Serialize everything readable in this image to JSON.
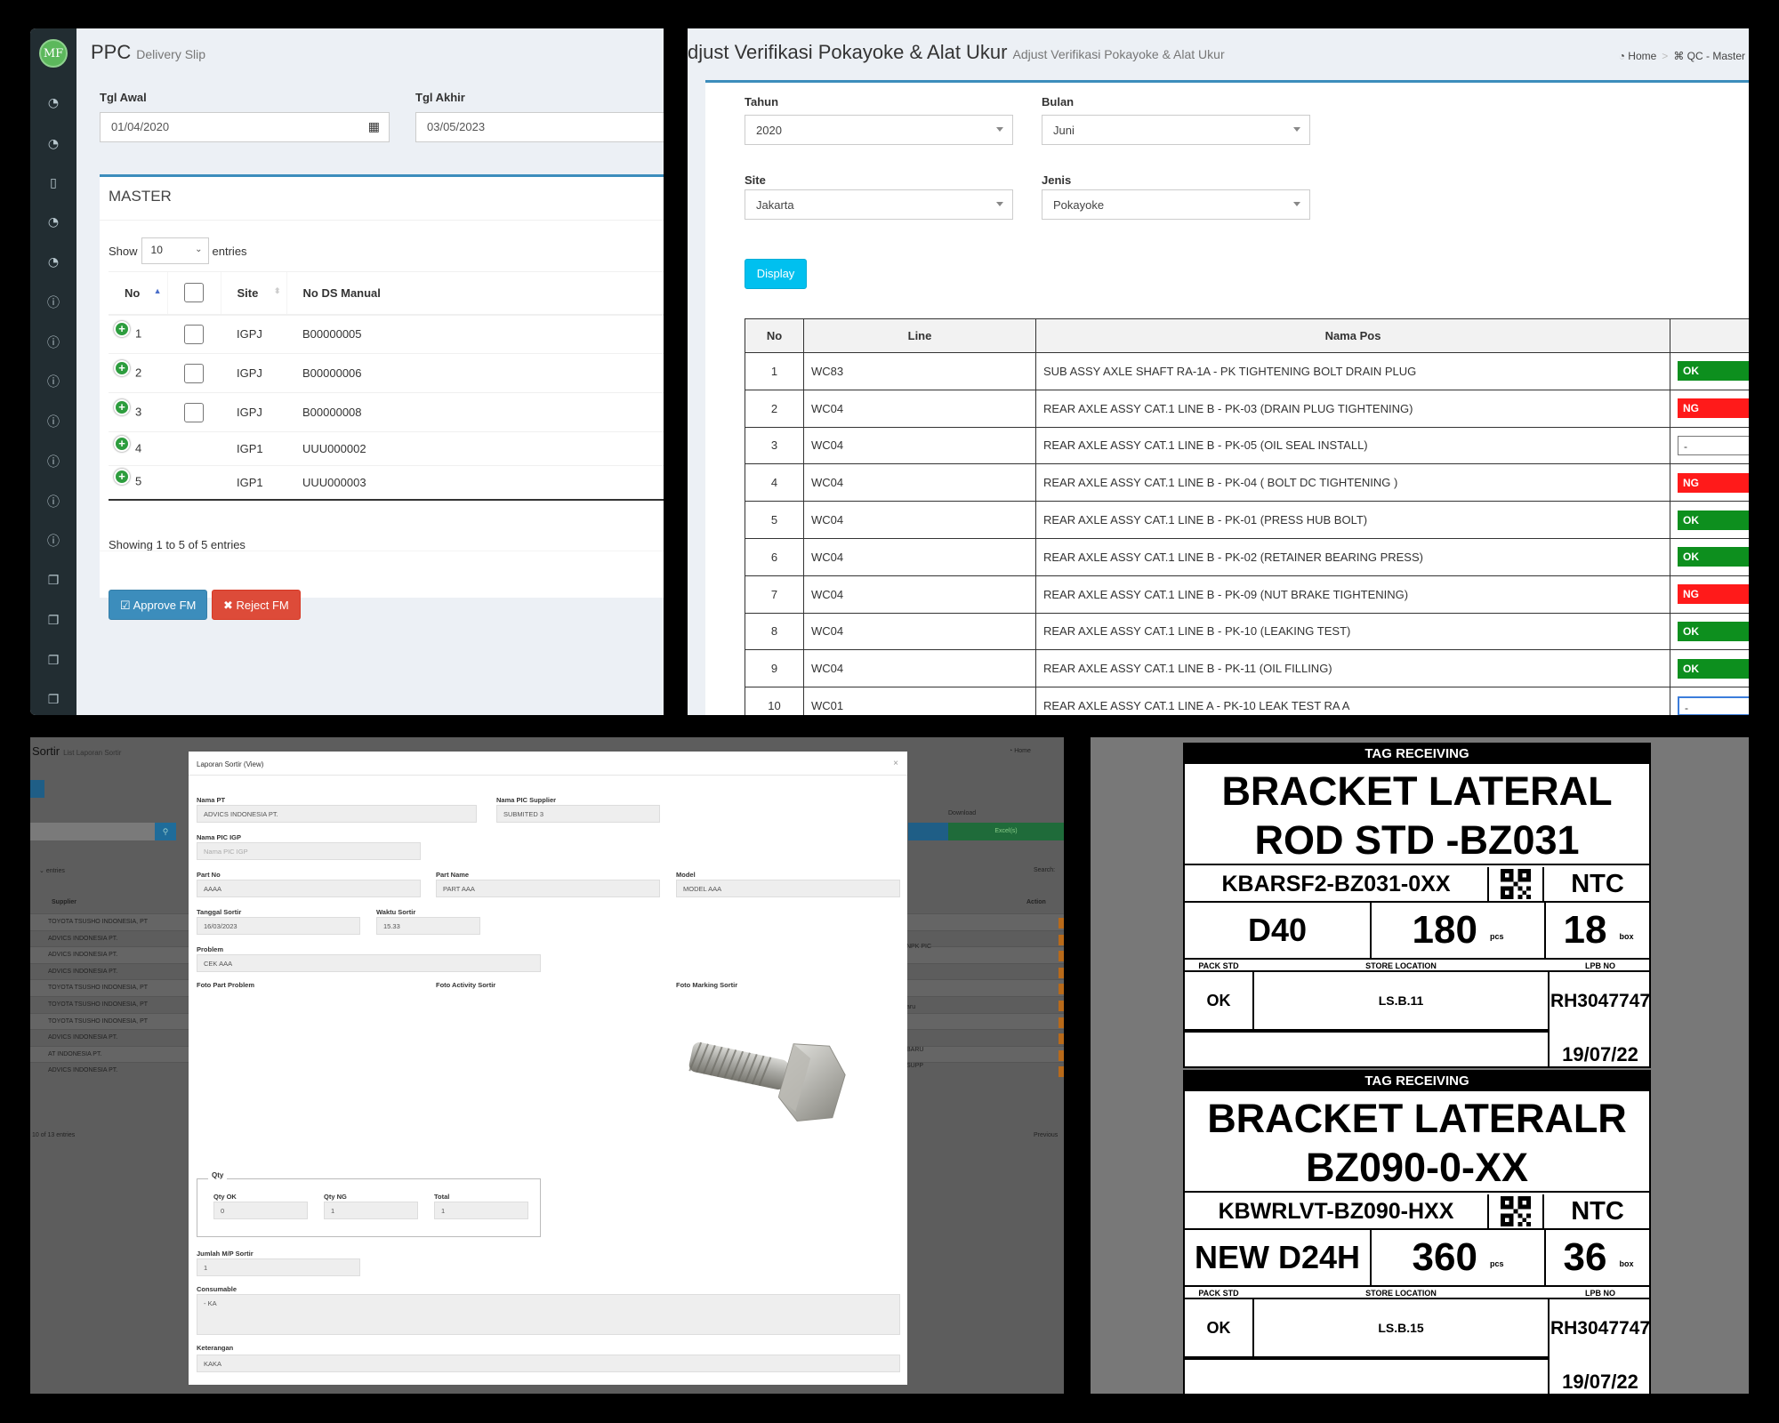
{
  "ppc": {
    "logo": "MF",
    "title": "PPC",
    "subtitle": "Delivery Slip",
    "tgl_awal_label": "Tgl Awal",
    "tgl_awal_value": "01/04/2020",
    "tgl_akhir_label": "Tgl Akhir",
    "tgl_akhir_value": "03/05/2023",
    "box_title": "MASTER",
    "show_label": "Show",
    "page_size": "10",
    "entries_label": "entries",
    "columns": [
      "No",
      "Site",
      "No DS Manual"
    ],
    "rows": [
      {
        "no": "1",
        "site": "IGPJ",
        "ds": "B00000005"
      },
      {
        "no": "2",
        "site": "IGPJ",
        "ds": "B00000006"
      },
      {
        "no": "3",
        "site": "IGPJ",
        "ds": "B00000008"
      },
      {
        "no": "4",
        "site": "IGP1",
        "ds": "UUU000002"
      },
      {
        "no": "5",
        "site": "IGP1",
        "ds": "UUU000003"
      }
    ],
    "showing": "Showing 1 to 5 of 5 entries",
    "approve_label": "Approve FM",
    "reject_label": "Reject FM"
  },
  "verif": {
    "title": "djust Verifikasi Pokayoke & Alat Ukur",
    "subtitle": "Adjust Verifikasi Pokayoke & Alat Ukur",
    "breadcrumb": [
      "Home",
      "QC - Master"
    ],
    "tahun_label": "Tahun",
    "tahun_value": "2020",
    "bulan_label": "Bulan",
    "bulan_value": "Juni",
    "site_label": "Site",
    "site_value": "Jakarta",
    "jenis_label": "Jenis",
    "jenis_value": "Pokayoke",
    "display_label": "Display",
    "columns": [
      "No",
      "Line",
      "Nama Pos"
    ],
    "rows": [
      {
        "no": "1",
        "line": "WC83",
        "pos": "SUB ASSY AXLE SHAFT RA-1A - PK TIGHTENING BOLT DRAIN PLUG",
        "status": "OK"
      },
      {
        "no": "2",
        "line": "WC04",
        "pos": "REAR AXLE ASSY CAT.1 LINE B - PK-03 (DRAIN PLUG TIGHTENING)",
        "status": "NG"
      },
      {
        "no": "3",
        "line": "WC04",
        "pos": "REAR AXLE ASSY CAT.1 LINE B - PK-05 (OIL SEAL INSTALL)",
        "status": "-"
      },
      {
        "no": "4",
        "line": "WC04",
        "pos": "REAR AXLE ASSY CAT.1 LINE B - PK-04 ( BOLT DC TIGHTENING )",
        "status": "NG"
      },
      {
        "no": "5",
        "line": "WC04",
        "pos": "REAR AXLE ASSY CAT.1 LINE B - PK-01 (PRESS HUB BOLT)",
        "status": "OK"
      },
      {
        "no": "6",
        "line": "WC04",
        "pos": "REAR AXLE ASSY CAT.1 LINE B - PK-02 (RETAINER BEARING PRESS)",
        "status": "OK"
      },
      {
        "no": "7",
        "line": "WC04",
        "pos": "REAR AXLE ASSY CAT.1 LINE B - PK-09 (NUT BRAKE TIGHTENING)",
        "status": "NG"
      },
      {
        "no": "8",
        "line": "WC04",
        "pos": "REAR AXLE ASSY CAT.1 LINE B - PK-10 (LEAKING TEST)",
        "status": "OK"
      },
      {
        "no": "9",
        "line": "WC04",
        "pos": "REAR AXLE ASSY CAT.1 LINE B - PK-11 (OIL FILLING)",
        "status": "OK"
      },
      {
        "no": "10",
        "line": "WC01",
        "pos": "REAR AXLE ASSY CAT.1 LINE A - PK-10 LEAK TEST RA A",
        "status": "-"
      }
    ]
  },
  "sortir": {
    "bg_title": "Sortir",
    "bg_subtitle": "List Laporan Sortir",
    "bg_home": "Home",
    "bg_download": "Download",
    "bg_excel": "Excel(s)",
    "bg_entries": "entries",
    "bg_search": "Search:",
    "bg_supplier_col": "Supplier",
    "bg_action_col": "Action",
    "bg_suppliers": [
      "TOYOTA TSUSHO INDONESIA, PT",
      "ADVICS INDONESIA PT.",
      "ADVICS INDONESIA PT.",
      "ADVICS INDONESIA PT.",
      "TOYOTA TSUSHO INDONESIA, PT",
      "TOYOTA TSUSHO INDONESIA, PT",
      "TOYOTA TSUSHO INDONESIA, PT",
      "ADVICS INDONESIA PT.",
      "AT INDONESIA PT.",
      "ADVICS INDONESIA PT."
    ],
    "bg_notes": [
      "NPK PIC",
      "aru",
      "BARU",
      "SUPP"
    ],
    "bg_footer": "10 of 13 entries",
    "bg_previous": "Previous",
    "modal_title": "Laporan Sortir (View)",
    "close": "×",
    "nama_pt_label": "Nama PT",
    "nama_pt": "ADVICS INDONESIA PT.",
    "pic_supplier_label": "Nama PIC Supplier",
    "pic_supplier": "SUBMITED 3",
    "pic_igp_label": "Nama PIC IGP",
    "pic_igp_placeholder": "Nama PIC IGP",
    "part_no_label": "Part No",
    "part_no": "AAAA",
    "part_name_label": "Part Name",
    "part_name": "PART AAA",
    "model_label": "Model",
    "model": "MODEL AAA",
    "tanggal_label": "Tanggal Sortir",
    "tanggal": "16/03/2023",
    "waktu_label": "Waktu Sortir",
    "waktu": "15.33",
    "problem_label": "Problem",
    "problem": "CEK AAA",
    "foto_problem_label": "Foto Part Problem",
    "foto_activity_label": "Foto Activity Sortir",
    "foto_marking_label": "Foto Marking Sortir",
    "qty_legend": "Qty",
    "qty_ok_label": "Qty OK",
    "qty_ok": "0",
    "qty_ng_label": "Qty NG",
    "qty_ng": "1",
    "total_label": "Total",
    "total": "1",
    "jumlah_label": "Jumlah M/P Sortir",
    "jumlah": "1",
    "consumable_label": "Consumable",
    "consumable": "- KA",
    "keterangan_label": "Keterangan",
    "keterangan": "KAKA"
  },
  "tags": [
    {
      "header": "TAG RECEIVING",
      "name_line1": "BRACKET LATERAL",
      "name_line2": "ROD STD -BZ031",
      "part_code": "KBARSF2-BZ031-0XX",
      "supplier": "NTC",
      "model": "D40",
      "qty": "180",
      "qty_unit": "pcs",
      "box": "18",
      "box_unit": "box",
      "pack_std_label": "PACK STD",
      "store_loc_label": "STORE LOCATION",
      "lpb_label": "LPB NO",
      "pack_std": "OK",
      "store_loc": "LS.B.11",
      "lpb_no": "RH3047747",
      "date": "19/07/22"
    },
    {
      "header": "TAG RECEIVING",
      "name_line1": "BRACKET LATERALR",
      "name_line2": "BZ090-0-XX",
      "part_code": "KBWRLVT-BZ090-HXX",
      "supplier": "NTC",
      "model": "NEW D24H",
      "qty": "360",
      "qty_unit": "pcs",
      "box": "36",
      "box_unit": "box",
      "pack_std_label": "PACK STD",
      "store_loc_label": "STORE LOCATION",
      "lpb_label": "LPB NO",
      "pack_std": "OK",
      "store_loc": "LS.B.15",
      "lpb_no": "RH3047747",
      "date": "19/07/22"
    }
  ]
}
